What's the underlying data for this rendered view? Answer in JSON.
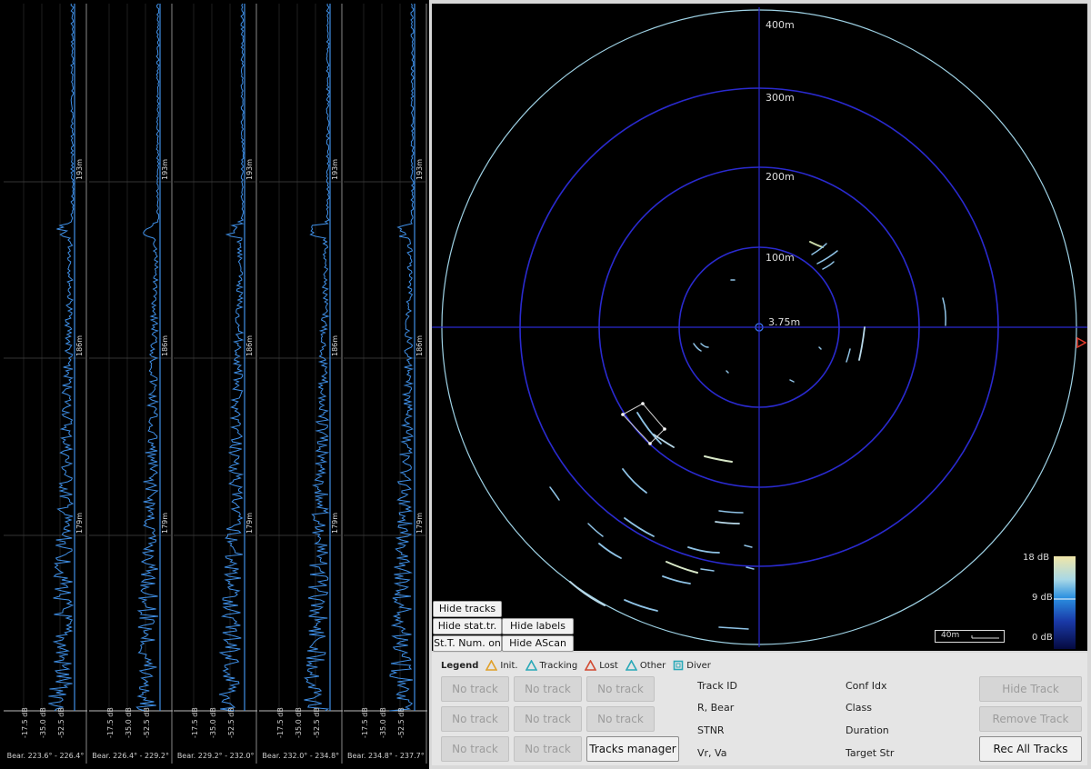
{
  "ascan": {
    "range_labels": [
      "193m",
      "186m",
      "179m"
    ],
    "db_labels": [
      "-17.5 dB",
      "-35.0 dB",
      "-52.5 dB"
    ],
    "columns": [
      {
        "bearing": "Bear. 223.6° - 226.4°"
      },
      {
        "bearing": "Bear. 226.4° - 229.2°"
      },
      {
        "bearing": "Bear. 229.2° - 232.0°"
      },
      {
        "bearing": "Bear. 232.0° - 234.8°"
      },
      {
        "bearing": "Bear. 234.8° - 237.7°"
      }
    ]
  },
  "sonar": {
    "range_rings": [
      "400m",
      "300m",
      "200m",
      "100m"
    ],
    "center_label": "3.75m",
    "scale_bar": "40m",
    "colorbar": {
      "max": "18 dB",
      "mid": "9 dB",
      "min": "0 dB"
    },
    "overlay_buttons": {
      "hide_tracks": "Hide tracks",
      "hide_stat_tr": "Hide stat.tr.",
      "hide_labels": "Hide labels",
      "st_num_on": "St.T. Num. on",
      "hide_ascan": "Hide AScan"
    }
  },
  "legend": {
    "title": "Legend",
    "items": [
      {
        "label": "Init.",
        "color": "#e0a02a",
        "shape": "triangle"
      },
      {
        "label": "Tracking",
        "color": "#2aa9b8",
        "shape": "triangle"
      },
      {
        "label": "Lost",
        "color": "#d24a32",
        "shape": "triangle"
      },
      {
        "label": "Other",
        "color": "#2aa9b8",
        "shape": "triangle"
      },
      {
        "label": "Diver",
        "color": "#2aa9b8",
        "shape": "square"
      }
    ]
  },
  "tracks": {
    "slot_label": "No track",
    "manager_label": "Tracks manager"
  },
  "track_info": {
    "left": [
      "Track ID",
      "R, Bear",
      "STNR",
      "Vr, Va"
    ],
    "right": [
      "Conf Idx",
      "Class",
      "Duration",
      "Target Str"
    ]
  },
  "actions": {
    "hide_track": "Hide Track",
    "remove_track": "Remove Track",
    "rec_all_tracks": "Rec All Tracks"
  },
  "colors": {
    "ring": "#2a2acf",
    "outer_ring": "#9fd3e6",
    "signal": "#3f8fe6",
    "target_marker": "#e23a2a"
  }
}
